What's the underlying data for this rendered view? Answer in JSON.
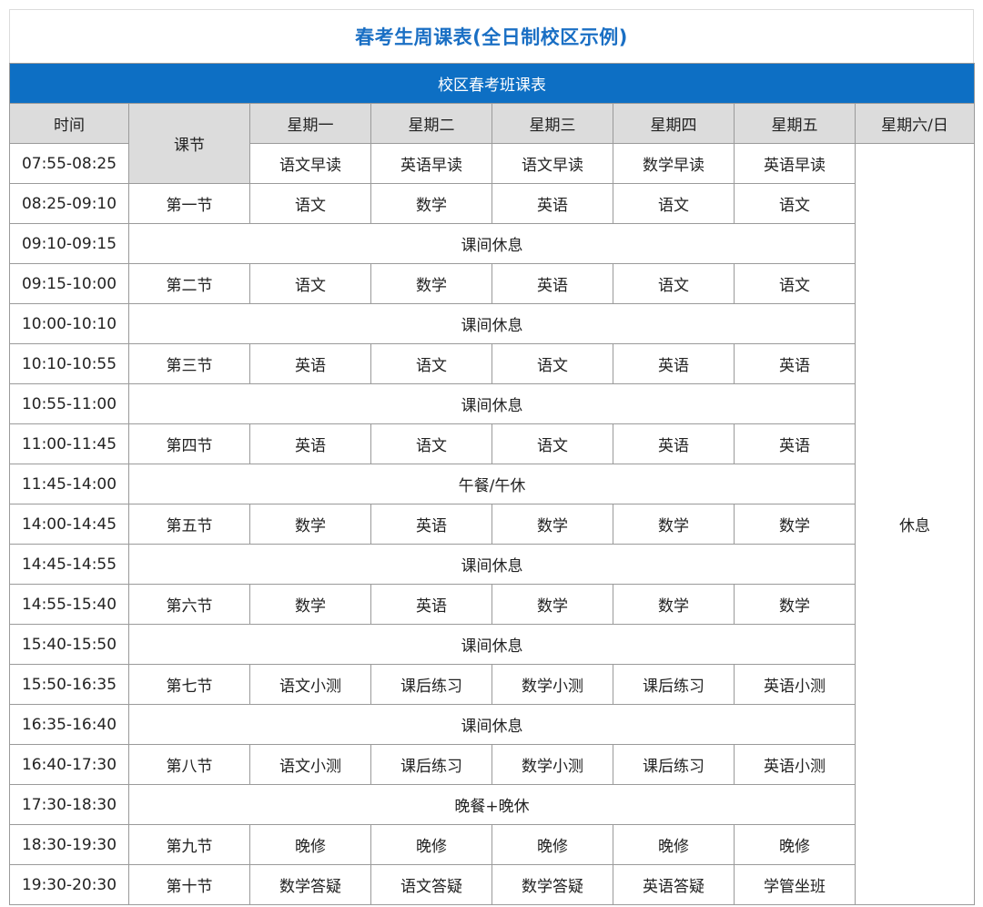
{
  "title": "春考生周课表(全日制校区示例)",
  "banner": "校区春考班课表",
  "headers": {
    "time": "时间",
    "section": "课节",
    "days": [
      "星期一",
      "星期二",
      "星期三",
      "星期四",
      "星期五"
    ],
    "weekend": "星期六/日"
  },
  "weekend_value": "休息",
  "rows": [
    {
      "time": "07:55-08:25",
      "section": "",
      "cells": [
        "语文早读",
        "英语早读",
        "语文早读",
        "数学早读",
        "英语早读"
      ]
    },
    {
      "time": "08:25-09:10",
      "section": "第一节",
      "cells": [
        "语文",
        "数学",
        "英语",
        "语文",
        "语文"
      ]
    },
    {
      "time": "09:10-09:15",
      "span": "课间休息"
    },
    {
      "time": "09:15-10:00",
      "section": "第二节",
      "cells": [
        "语文",
        "数学",
        "英语",
        "语文",
        "语文"
      ]
    },
    {
      "time": "10:00-10:10",
      "span": "课间休息"
    },
    {
      "time": "10:10-10:55",
      "section": "第三节",
      "cells": [
        "英语",
        "语文",
        "语文",
        "英语",
        "英语"
      ]
    },
    {
      "time": "10:55-11:00",
      "span": "课间休息"
    },
    {
      "time": "11:00-11:45",
      "section": "第四节",
      "cells": [
        "英语",
        "语文",
        "语文",
        "英语",
        "英语"
      ]
    },
    {
      "time": "11:45-14:00",
      "span": "午餐/午休"
    },
    {
      "time": "14:00-14:45",
      "section": "第五节",
      "cells": [
        "数学",
        "英语",
        "数学",
        "数学",
        "数学"
      ]
    },
    {
      "time": "14:45-14:55",
      "span": "课间休息"
    },
    {
      "time": "14:55-15:40",
      "section": "第六节",
      "cells": [
        "数学",
        "英语",
        "数学",
        "数学",
        "数学"
      ]
    },
    {
      "time": "15:40-15:50",
      "span": "课间休息"
    },
    {
      "time": "15:50-16:35",
      "section": "第七节",
      "cells": [
        "语文小测",
        "课后练习",
        "数学小测",
        "课后练习",
        "英语小测"
      ]
    },
    {
      "time": "16:35-16:40",
      "span": "课间休息"
    },
    {
      "time": "16:40-17:30",
      "section": "第八节",
      "cells": [
        "语文小测",
        "课后练习",
        "数学小测",
        "课后练习",
        "英语小测"
      ]
    },
    {
      "time": "17:30-18:30",
      "span": "晚餐+晚休"
    },
    {
      "time": "18:30-19:30",
      "section": "第九节",
      "cells": [
        "晚修",
        "晚修",
        "晚修",
        "晚修",
        "晚修"
      ]
    },
    {
      "time": "19:30-20:30",
      "section": "第十节",
      "cells": [
        "数学答疑",
        "语文答疑",
        "数学答疑",
        "英语答疑",
        "学管坐班"
      ]
    }
  ]
}
